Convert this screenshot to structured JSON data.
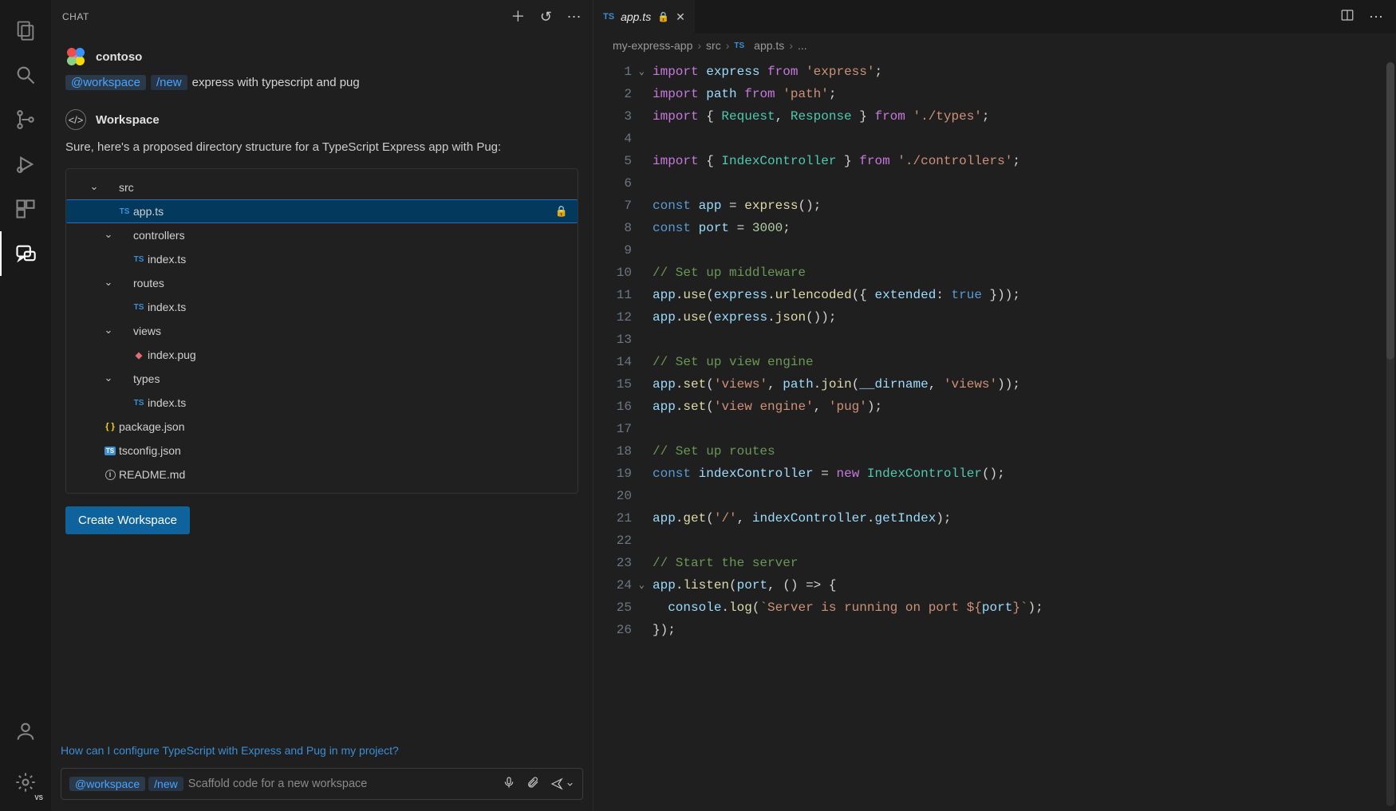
{
  "chat": {
    "header_title": "CHAT",
    "user_name": "contoso",
    "workspace_pill": "@workspace",
    "new_pill": "/new",
    "user_prompt_rest": "express with typescript and pug",
    "reply_heading": "Workspace",
    "reply_text": "Sure, here's a proposed directory structure for a TypeScript Express app with Pug:",
    "create_button": "Create Workspace",
    "suggestion": "How can I configure TypeScript with Express and Pug in my project?",
    "input_placeholder": "Scaffold code for a new workspace"
  },
  "tree": [
    {
      "depth": 1,
      "kind": "folder",
      "label": "src",
      "chevron": "down"
    },
    {
      "depth": 2,
      "kind": "ts",
      "label": "app.ts",
      "selected": true,
      "locked": true
    },
    {
      "depth": 2,
      "kind": "folder",
      "label": "controllers",
      "chevron": "down"
    },
    {
      "depth": 3,
      "kind": "ts",
      "label": "index.ts"
    },
    {
      "depth": 2,
      "kind": "folder",
      "label": "routes",
      "chevron": "down"
    },
    {
      "depth": 3,
      "kind": "ts",
      "label": "index.ts"
    },
    {
      "depth": 2,
      "kind": "folder",
      "label": "views",
      "chevron": "down"
    },
    {
      "depth": 3,
      "kind": "pug",
      "label": "index.pug"
    },
    {
      "depth": 2,
      "kind": "folder",
      "label": "types",
      "chevron": "down"
    },
    {
      "depth": 3,
      "kind": "ts",
      "label": "index.ts"
    },
    {
      "depth": 1,
      "kind": "json",
      "label": "package.json"
    },
    {
      "depth": 1,
      "kind": "tsconf",
      "label": "tsconfig.json"
    },
    {
      "depth": 1,
      "kind": "readme",
      "label": "README.md"
    }
  ],
  "editor": {
    "tab_file": "app.ts",
    "tab_readonly": true,
    "breadcrumbs": [
      "my-express-app",
      "src",
      "app.ts",
      "..."
    ],
    "lines": [
      [
        [
          "kw",
          "import"
        ],
        [
          "sp",
          " "
        ],
        [
          "id",
          "express"
        ],
        [
          "sp",
          " "
        ],
        [
          "from",
          "from"
        ],
        [
          "sp",
          " "
        ],
        [
          "str",
          "'express'"
        ],
        [
          "pn",
          ";"
        ]
      ],
      [
        [
          "kw",
          "import"
        ],
        [
          "sp",
          " "
        ],
        [
          "id",
          "path"
        ],
        [
          "sp",
          " "
        ],
        [
          "from",
          "from"
        ],
        [
          "sp",
          " "
        ],
        [
          "str",
          "'path'"
        ],
        [
          "pn",
          ";"
        ]
      ],
      [
        [
          "kw",
          "import"
        ],
        [
          "sp",
          " "
        ],
        [
          "pn",
          "{ "
        ],
        [
          "type",
          "Request"
        ],
        [
          "pn",
          ", "
        ],
        [
          "type",
          "Response"
        ],
        [
          "pn",
          " }"
        ],
        [
          "sp",
          " "
        ],
        [
          "from",
          "from"
        ],
        [
          "sp",
          " "
        ],
        [
          "str",
          "'./types'"
        ],
        [
          "pn",
          ";"
        ]
      ],
      [],
      [
        [
          "kw",
          "import"
        ],
        [
          "sp",
          " "
        ],
        [
          "pn",
          "{ "
        ],
        [
          "type",
          "IndexController"
        ],
        [
          "pn",
          " }"
        ],
        [
          "sp",
          " "
        ],
        [
          "from",
          "from"
        ],
        [
          "sp",
          " "
        ],
        [
          "str",
          "'./controllers'"
        ],
        [
          "pn",
          ";"
        ]
      ],
      [],
      [
        [
          "const",
          "const"
        ],
        [
          "sp",
          " "
        ],
        [
          "id",
          "app"
        ],
        [
          "sp",
          " "
        ],
        [
          "op",
          "="
        ],
        [
          "sp",
          " "
        ],
        [
          "fn",
          "express"
        ],
        [
          "pn",
          "();"
        ]
      ],
      [
        [
          "const",
          "const"
        ],
        [
          "sp",
          " "
        ],
        [
          "id",
          "port"
        ],
        [
          "sp",
          " "
        ],
        [
          "op",
          "="
        ],
        [
          "sp",
          " "
        ],
        [
          "num",
          "3000"
        ],
        [
          "pn",
          ";"
        ]
      ],
      [],
      [
        [
          "cmt",
          "// Set up middleware"
        ]
      ],
      [
        [
          "id",
          "app"
        ],
        [
          "pn",
          "."
        ],
        [
          "fn",
          "use"
        ],
        [
          "pn",
          "("
        ],
        [
          "id",
          "express"
        ],
        [
          "pn",
          "."
        ],
        [
          "fn",
          "urlencoded"
        ],
        [
          "pn",
          "({ "
        ],
        [
          "id",
          "extended"
        ],
        [
          "pn",
          ": "
        ],
        [
          "const",
          "true"
        ],
        [
          "pn",
          " }));"
        ]
      ],
      [
        [
          "id",
          "app"
        ],
        [
          "pn",
          "."
        ],
        [
          "fn",
          "use"
        ],
        [
          "pn",
          "("
        ],
        [
          "id",
          "express"
        ],
        [
          "pn",
          "."
        ],
        [
          "fn",
          "json"
        ],
        [
          "pn",
          "());"
        ]
      ],
      [],
      [
        [
          "cmt",
          "// Set up view engine"
        ]
      ],
      [
        [
          "id",
          "app"
        ],
        [
          "pn",
          "."
        ],
        [
          "fn",
          "set"
        ],
        [
          "pn",
          "("
        ],
        [
          "str",
          "'views'"
        ],
        [
          "pn",
          ", "
        ],
        [
          "id",
          "path"
        ],
        [
          "pn",
          "."
        ],
        [
          "fn",
          "join"
        ],
        [
          "pn",
          "("
        ],
        [
          "id",
          "__dirname"
        ],
        [
          "pn",
          ", "
        ],
        [
          "str",
          "'views'"
        ],
        [
          "pn",
          "));"
        ]
      ],
      [
        [
          "id",
          "app"
        ],
        [
          "pn",
          "."
        ],
        [
          "fn",
          "set"
        ],
        [
          "pn",
          "("
        ],
        [
          "str",
          "'view engine'"
        ],
        [
          "pn",
          ", "
        ],
        [
          "str",
          "'pug'"
        ],
        [
          "pn",
          ");"
        ]
      ],
      [],
      [
        [
          "cmt",
          "// Set up routes"
        ]
      ],
      [
        [
          "const",
          "const"
        ],
        [
          "sp",
          " "
        ],
        [
          "id",
          "indexController"
        ],
        [
          "sp",
          " "
        ],
        [
          "op",
          "="
        ],
        [
          "sp",
          " "
        ],
        [
          "kw",
          "new"
        ],
        [
          "sp",
          " "
        ],
        [
          "type",
          "IndexController"
        ],
        [
          "pn",
          "();"
        ]
      ],
      [],
      [
        [
          "id",
          "app"
        ],
        [
          "pn",
          "."
        ],
        [
          "fn",
          "get"
        ],
        [
          "pn",
          "("
        ],
        [
          "str",
          "'/'"
        ],
        [
          "pn",
          ", "
        ],
        [
          "id",
          "indexController"
        ],
        [
          "pn",
          "."
        ],
        [
          "id",
          "getIndex"
        ],
        [
          "pn",
          ");"
        ]
      ],
      [],
      [
        [
          "cmt",
          "// Start the server"
        ]
      ],
      [
        [
          "id",
          "app"
        ],
        [
          "pn",
          "."
        ],
        [
          "fn",
          "listen"
        ],
        [
          "pn",
          "("
        ],
        [
          "id",
          "port"
        ],
        [
          "pn",
          ", () "
        ],
        [
          "op",
          "=>"
        ],
        [
          "pn",
          " {"
        ]
      ],
      [
        [
          "sp",
          "  "
        ],
        [
          "id",
          "console"
        ],
        [
          "pn",
          "."
        ],
        [
          "fn",
          "log"
        ],
        [
          "pn",
          "("
        ],
        [
          "str",
          "`Server is running on port ${"
        ],
        [
          "id",
          "port"
        ],
        [
          "str",
          "}`"
        ],
        [
          "pn",
          ");"
        ]
      ],
      [
        [
          "pn",
          "});"
        ]
      ]
    ],
    "fold_lines": [
      1,
      24
    ]
  }
}
